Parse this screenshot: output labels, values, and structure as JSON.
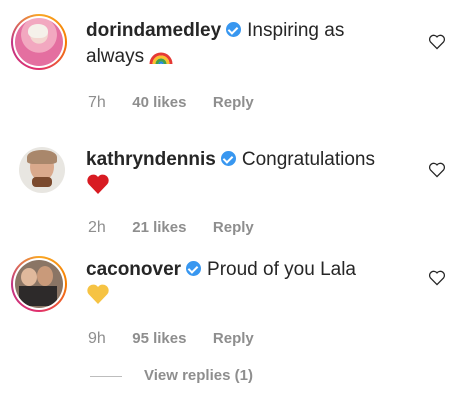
{
  "comments": [
    {
      "username": "dorindamedley",
      "text": "Inspiring as",
      "text2": "always",
      "emoji": "rainbow-emoji",
      "time": "7h",
      "likes": "40 likes",
      "reply": "Reply"
    },
    {
      "username": "kathryndennis",
      "text": "Congratulations",
      "emoji": "red-heart-emoji",
      "time": "2h",
      "likes": "21 likes",
      "reply": "Reply"
    },
    {
      "username": "caconover",
      "text": "Proud of you Lala",
      "emoji": "yellow-heart-emoji",
      "time": "9h",
      "likes": "95 likes",
      "reply": "Reply"
    }
  ],
  "view_replies": "View replies (1)",
  "colors": {
    "verified": "#3897f0",
    "meta": "#8e8e8e",
    "red_heart": "#d81b22",
    "yellow_heart": "#f6c343"
  }
}
